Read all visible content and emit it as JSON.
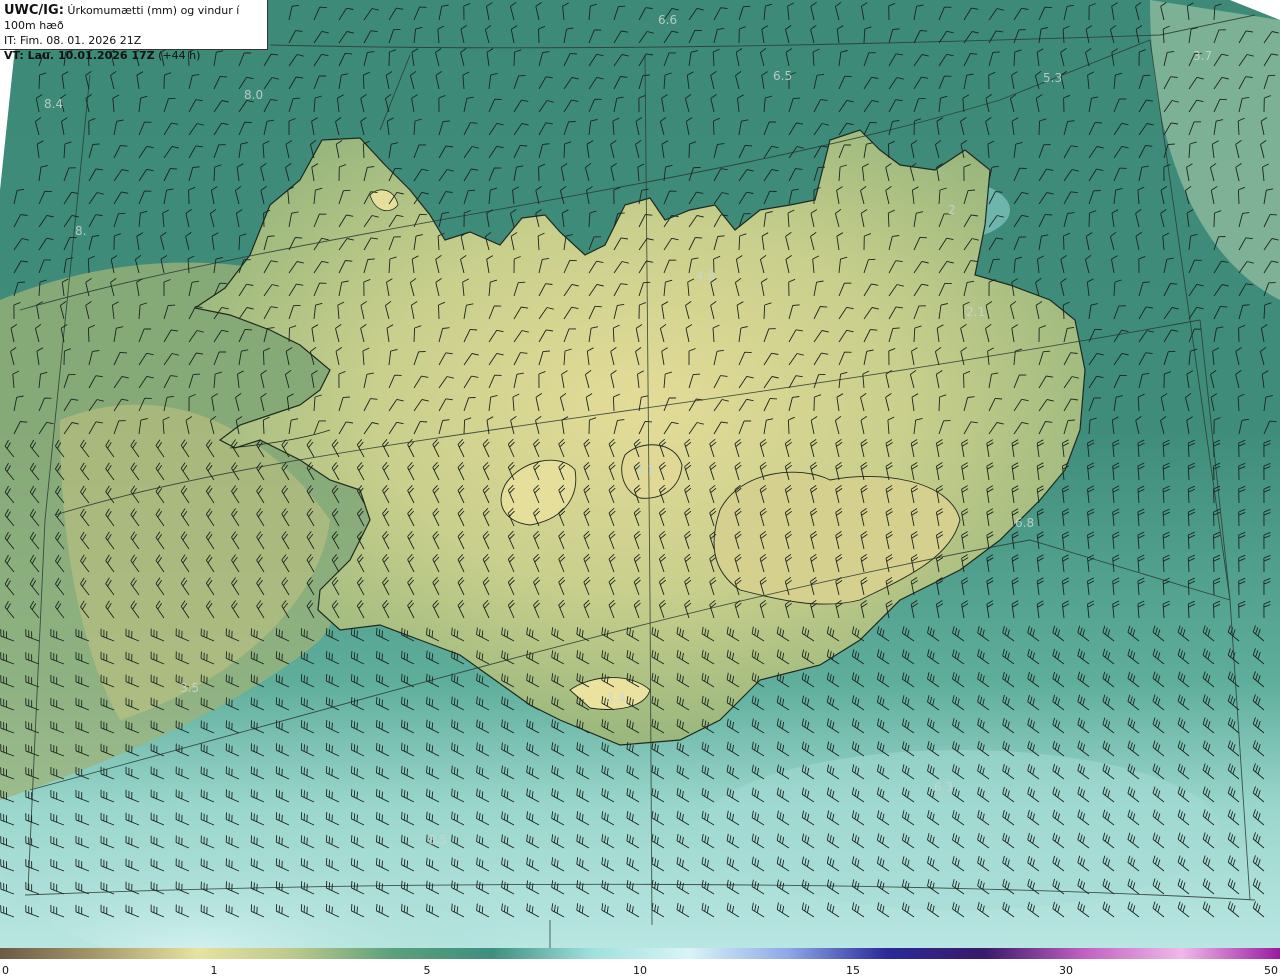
{
  "header": {
    "product": "UWC/IG:",
    "title": "Úrkomumætti (mm) og vindur í 100m hæð",
    "it_label": "IT:",
    "it_value": "Fim. 08. 01. 2026 21Z",
    "vt_label": "VT:",
    "vt_value": "Lau. 10.01.2026 17Z",
    "lead": "(+44 h)"
  },
  "value_labels": [
    "6.6",
    "6.5",
    "5.3",
    "3.7",
    "8.4",
    "8.0",
    "8.",
    "4.8",
    "2",
    "2.1",
    "4.1",
    "6.8",
    "3.5",
    "3.4",
    "6.3",
    "8.5"
  ],
  "colorbar": {
    "ticks": [
      "0",
      "1",
      "5",
      "10",
      "15",
      "30",
      "50"
    ],
    "colors": [
      "#6e5a45",
      "#a89a6a",
      "#e8e2a0",
      "#b9c98a",
      "#5aa07a",
      "#3f8f80",
      "#9fe0dc",
      "#d8f4f6",
      "#8fa8e8",
      "#2a2a9a",
      "#3a1a6a",
      "#c060c0",
      "#f0b8e8",
      "#9a1aa0"
    ]
  },
  "icons": [
    "wind-barb-icon"
  ]
}
